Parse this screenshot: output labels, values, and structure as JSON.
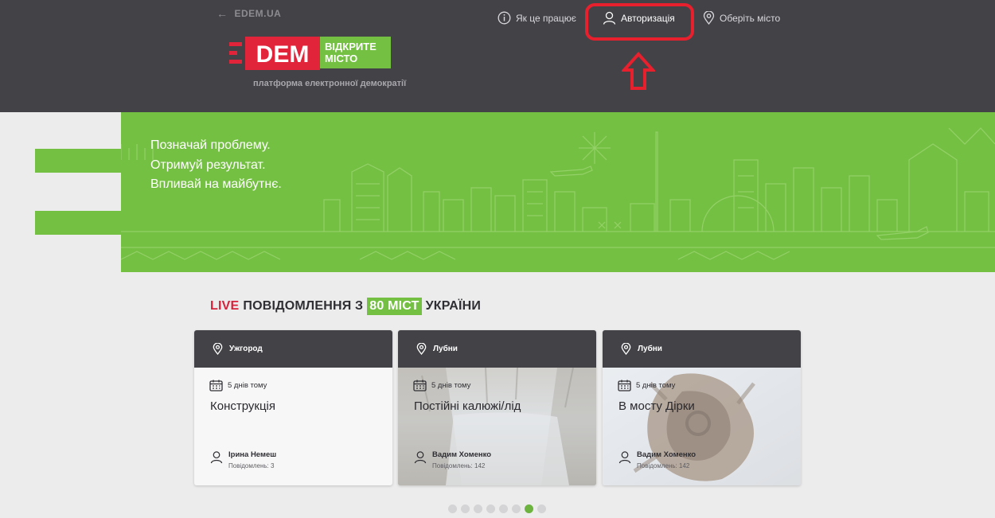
{
  "header": {
    "back_link": "EDEM.UA",
    "logo_text": "DEM",
    "logo_sub_line1": "ВІДКРИТЕ",
    "logo_sub_line2": "МІСТО",
    "tagline": "платформа електронної демократії",
    "nav": {
      "how_it_works": "Як це працює",
      "authorization": "Авторизація",
      "choose_city": "Оберіть місто"
    }
  },
  "banner": {
    "line1": "Позначай проблему.",
    "line2": "Отримуй результат.",
    "line3": "Впливай на майбутнє."
  },
  "section": {
    "live": "LIVE",
    "part1": "ПОВІДОМЛЕННЯ З",
    "badge": "80 МІСТ",
    "part2": "УКРАЇНИ"
  },
  "cards": [
    {
      "city": "Ужгород",
      "date": "5 днів тому",
      "title": "Конструкція",
      "author": "Ірина Немеш",
      "count": "Повідомлень: 3"
    },
    {
      "city": "Лубни",
      "date": "5 днів тому",
      "title": "Постійні калюжі/лід",
      "author": "Вадим Хоменко",
      "count": "Повідомлень: 142"
    },
    {
      "city": "Лубни",
      "date": "5 днів тому",
      "title": "В мосту Дірки",
      "author": "Вадим Хоменко",
      "count": "Повідомлень: 142"
    }
  ],
  "pagination": {
    "total": 8,
    "active_index": 6
  },
  "colors": {
    "header_bg": "#434247",
    "brand_red": "#d4233a",
    "brand_green": "#74c043",
    "highlight_red": "#e8202e"
  }
}
